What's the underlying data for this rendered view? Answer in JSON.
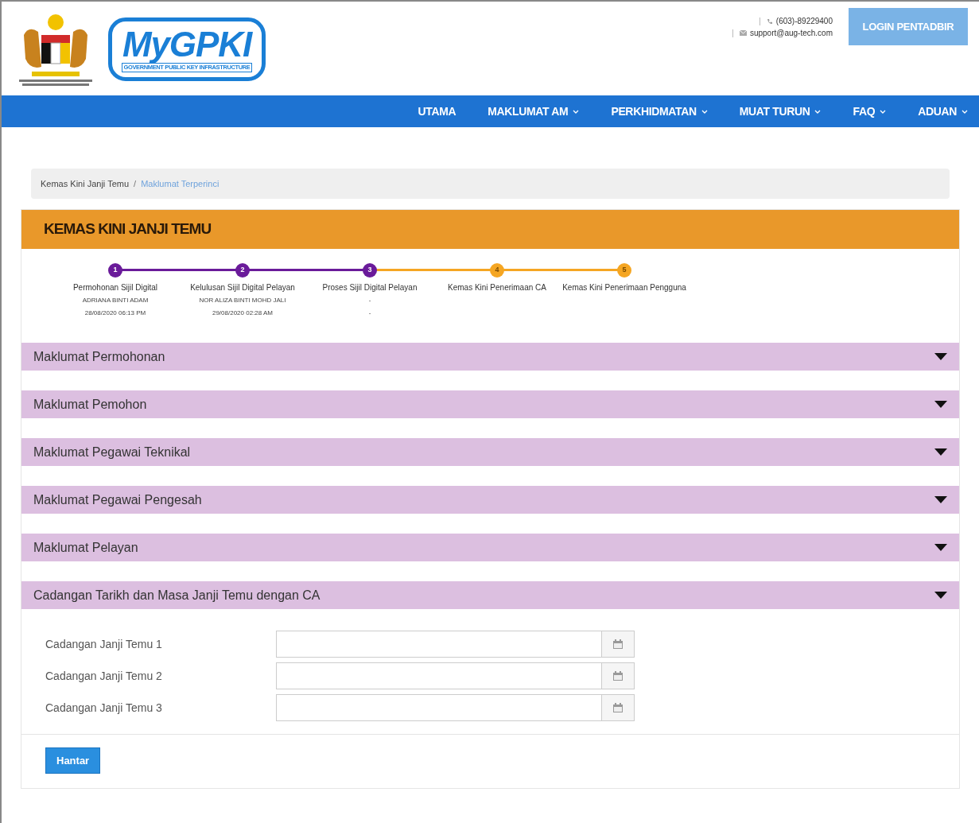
{
  "header": {
    "logo_text": "MyGPKI",
    "logo_subtitle": "GOVERNMENT PUBLIC KEY INFRASTRUCTURE",
    "phone": "(603)-89229400",
    "email": "support@aug-tech.com",
    "login_button": "LOGIN PENTADBIR"
  },
  "nav": [
    {
      "label": "UTAMA",
      "dropdown": false
    },
    {
      "label": "MAKLUMAT AM",
      "dropdown": true
    },
    {
      "label": "PERKHIDMATAN",
      "dropdown": true
    },
    {
      "label": "MUAT TURUN",
      "dropdown": true
    },
    {
      "label": "FAQ",
      "dropdown": true
    },
    {
      "label": "ADUAN",
      "dropdown": true
    }
  ],
  "breadcrumb_separator": "/",
  "breadcrumb": [
    {
      "label": "Kemas Kini Janji Temu",
      "current": false
    },
    {
      "label": "Maklumat Terperinci",
      "current": true
    }
  ],
  "panel_title": "KEMAS KINI JANJI TEMU",
  "steps": [
    {
      "number": "1",
      "title": "Permohonan Sijil Digital",
      "completed": true,
      "lines": [
        "ADRIANA BINTI ADAM",
        "28/08/2020 06:13 PM"
      ]
    },
    {
      "number": "2",
      "title": "Kelulusan Sijil Digital Pelayan",
      "completed": true,
      "lines": [
        "NOR ALIZA BINTI MOHD JALI",
        "29/08/2020 02:28 AM"
      ]
    },
    {
      "number": "3",
      "title": "Proses Sijil Digital Pelayan",
      "completed": true,
      "lines": [
        "-",
        "-"
      ]
    },
    {
      "number": "4",
      "title": "Kemas Kini Penerimaan CA",
      "completed": false
    },
    {
      "number": "5",
      "title": "Kemas Kini Penerimaan Pengguna",
      "completed": false
    }
  ],
  "sections": [
    {
      "title": "Maklumat Permohonan"
    },
    {
      "title": "Maklumat Pemohon"
    },
    {
      "title": "Maklumat Pegawai Teknikal"
    },
    {
      "title": "Maklumat Pegawai Pengesah"
    },
    {
      "title": "Maklumat Pelayan"
    },
    {
      "title": "Cadangan Tarikh dan Masa Janji Temu dengan CA",
      "fields": [
        {
          "label": "Cadangan Janji Temu 1"
        },
        {
          "label": "Cadangan Janji Temu 2"
        },
        {
          "label": "Cadangan Janji Temu 3"
        }
      ]
    }
  ],
  "submit_button": "Hantar"
}
